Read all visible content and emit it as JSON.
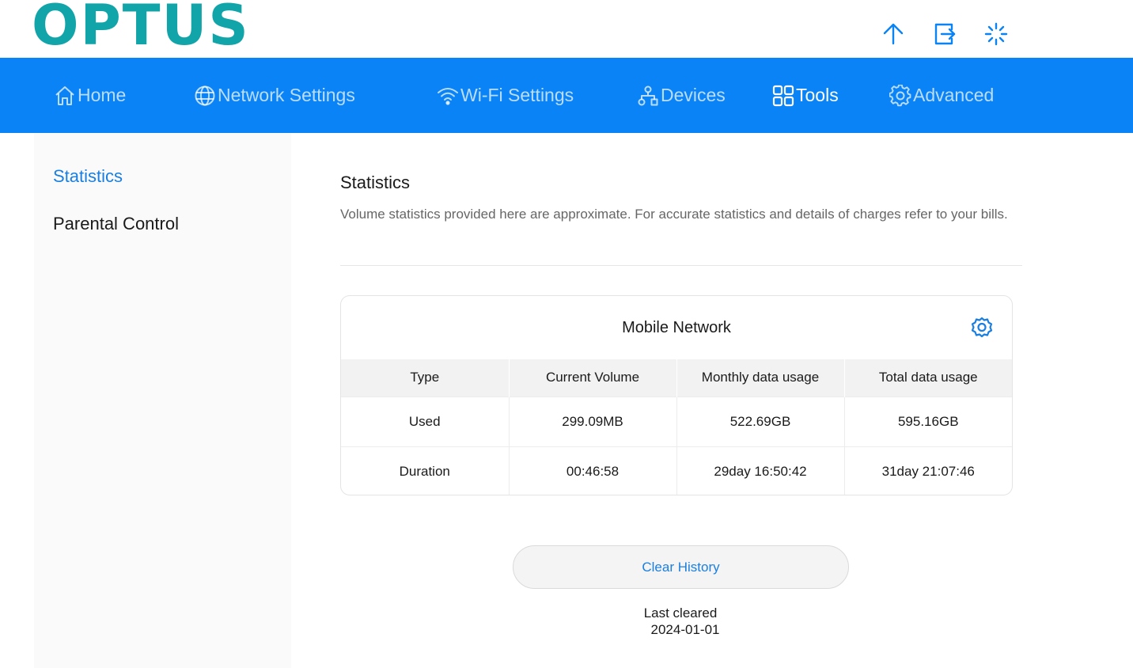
{
  "brand": {
    "logo_text": "OPTUS",
    "logo_color": "#11a4a8"
  },
  "header_icons": [
    {
      "name": "upload-icon"
    },
    {
      "name": "logout-icon"
    },
    {
      "name": "loading-spinner-icon"
    }
  ],
  "colors": {
    "nav_bg": "#0a83f7",
    "accent": "#1a7fe0"
  },
  "nav": {
    "items": [
      {
        "label": "Home",
        "icon": "home-icon"
      },
      {
        "label": "Network Settings",
        "icon": "globe-icon"
      },
      {
        "label": "Wi-Fi Settings",
        "icon": "wifi-icon"
      },
      {
        "label": "Devices",
        "icon": "devices-icon"
      },
      {
        "label": "Tools",
        "icon": "tools-grid-icon",
        "active": true
      },
      {
        "label": "Advanced",
        "icon": "gear-icon"
      }
    ]
  },
  "sidebar": {
    "items": [
      {
        "label": "Statistics",
        "active": true
      },
      {
        "label": "Parental Control",
        "active": false
      }
    ]
  },
  "main": {
    "title": "Statistics",
    "description": "Volume statistics provided here are approximate. For accurate statistics and details of charges refer to your bills.",
    "card": {
      "title": "Mobile Network",
      "columns": [
        "Type",
        "Current Volume",
        "Monthly data usage",
        "Total data usage"
      ],
      "rows": [
        [
          "Used",
          "299.09MB",
          "522.69GB",
          "595.16GB"
        ],
        [
          "Duration",
          "00:46:58",
          "29day 16:50:42",
          "31day 21:07:46"
        ]
      ]
    },
    "clear_button": "Clear History",
    "last_cleared_label": "Last cleared",
    "last_cleared_date": "2024-01-01"
  }
}
